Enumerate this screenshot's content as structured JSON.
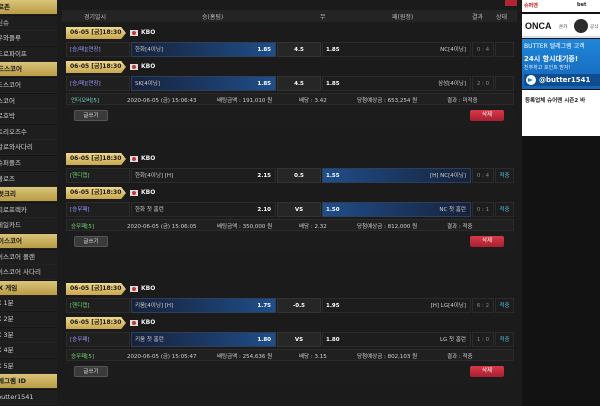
{
  "sidebar": {
    "items": [
      {
        "label": "로존",
        "style": "gold"
      },
      {
        "label": "신슈",
        "style": "dark"
      },
      {
        "label": "우와플루",
        "style": "dark"
      },
      {
        "label": "드로파이프",
        "style": "dark"
      },
      {
        "label": "드스코어",
        "style": "gold"
      },
      {
        "label": "드스코어",
        "style": "dark"
      },
      {
        "label": "스코어",
        "style": "dark"
      },
      {
        "label": "로호박",
        "style": "dark"
      },
      {
        "label": "트리오즈수",
        "style": "dark"
      },
      {
        "label": "알로와사다리",
        "style": "dark"
      },
      {
        "label": "슈퍼플즈",
        "style": "dark"
      },
      {
        "label": "볼로즈",
        "style": "dark"
      },
      {
        "label": "럿크리",
        "style": "gold"
      },
      {
        "label": "피로프렉카",
        "style": "dark"
      },
      {
        "label": "레일카드",
        "style": "dark"
      },
      {
        "label": "이스코어",
        "style": "gold"
      },
      {
        "label": "이스코어 플랜",
        "style": "dark"
      },
      {
        "label": "이스코어 사다리",
        "style": "dark"
      },
      {
        "label": "X 게임",
        "style": "gold"
      },
      {
        "label": "X 1분",
        "style": "dark"
      },
      {
        "label": "X 2분",
        "style": "dark"
      },
      {
        "label": "X 3분",
        "style": "dark"
      },
      {
        "label": "X 4분",
        "style": "dark"
      },
      {
        "label": "X 5분",
        "style": "dark"
      },
      {
        "label": "레그램 ID",
        "style": "gold"
      },
      {
        "label": "butter1541",
        "style": "dark"
      }
    ]
  },
  "header": {
    "col_time": "경기일시",
    "col_home": "승(홈팀)",
    "col_mid": "무",
    "col_away": "패(원정)",
    "col_result": "결과",
    "col_status": "상태"
  },
  "bets": [
    {
      "games": [
        {
          "date": "06-05 [금]18:30",
          "league": "KBO",
          "type": "[승/패][연장]",
          "type_style": "blue",
          "home": "한화[4이닝]",
          "home_odd": "1.85",
          "home_sel": true,
          "mid": "4.5",
          "away_odd": "1.85",
          "away": "NC[4이닝]",
          "away_sel": false,
          "score": "0 : 4",
          "status": ""
        },
        {
          "date": "06-05 [금]18:30",
          "league": "KBO",
          "type": "[승/패][연장]",
          "type_style": "blue",
          "home": "SK[4이닝]",
          "home_odd": "1.85",
          "home_sel": true,
          "mid": "4.5",
          "away_odd": "1.85",
          "away": "삼성[4이닝]",
          "away_sel": false,
          "score": "2 : 0",
          "status": ""
        }
      ],
      "summary": {
        "outcome": "언더오버[5]",
        "time": "2020-06-05 (금) 15:06:43",
        "amount": "배팅금액 : 191,010 원",
        "rate": "배당 : 3.42",
        "expected": "당첨예상금 : 653,254 원",
        "result": "결과 : 미적중"
      },
      "btn_left": "글쓰기",
      "btn_right": "삭제"
    },
    {
      "games": [
        {
          "date": "06-05 [금]18:30",
          "league": "KBO",
          "type": "[핸디캡]",
          "type_style": "green",
          "home": "한화[4이닝] [H]",
          "home_odd": "2.15",
          "home_sel": false,
          "mid": "0.5",
          "away_odd": "1.55",
          "away": "[H] NC[4이닝]",
          "away_sel": true,
          "score": "0 : 4",
          "status": "적중"
        },
        {
          "date": "06-05 [금]18:30",
          "league": "KBO",
          "type": "[승무패]",
          "type_style": "blue",
          "home": "한화 첫 홈런",
          "home_odd": "2.10",
          "home_sel": false,
          "mid": "VS",
          "away_odd": "1.50",
          "away": "NC 첫 홈런",
          "away_sel": true,
          "score": "0 : 1",
          "status": "적중"
        }
      ],
      "summary": {
        "outcome": "승무패[5]",
        "time": "2020-06-05 (금) 15:06:05",
        "amount": "배팅금액 : 350,000 원",
        "rate": "배당 : 2.32",
        "expected": "당첨예상금 : 812,000 원",
        "result": "결과 : 적중"
      },
      "btn_left": "글쓰기",
      "btn_right": "삭제"
    },
    {
      "games": [
        {
          "date": "06-05 [금]18:30",
          "league": "KBO",
          "type": "[핸디캡]",
          "type_style": "green",
          "home": "키움[4이닝] [H]",
          "home_odd": "1.75",
          "home_sel": true,
          "mid": "-0.5",
          "away_odd": "1.95",
          "away": "[H] LG[4이닝]",
          "away_sel": false,
          "score": "6 : 2",
          "status": "적중"
        },
        {
          "date": "06-05 [금]18:30",
          "league": "KBO",
          "type": "[승무패]",
          "type_style": "blue",
          "home": "키움 첫 홈런",
          "home_odd": "1.80",
          "home_sel": true,
          "mid": "VS",
          "away_odd": "1.80",
          "away": "LG 첫 홈런",
          "away_sel": false,
          "score": "1 : 0",
          "status": "적중"
        }
      ],
      "summary": {
        "outcome": "승무패[5]",
        "time": "2020-06-05 (금) 15:05:47",
        "amount": "배팅금액 : 254,636 원",
        "rate": "배당 : 3.15",
        "expected": "당첨예상금 : 802,103 원",
        "result": "결과 : 적중"
      },
      "btn_left": "글쓰기",
      "btn_right": "삭제"
    }
  ],
  "right_panel": {
    "top_ad_a": "슈퍼맨",
    "top_ad_b": "bet",
    "onca": "ONCA",
    "onca_sub1": "온카",
    "onca_sub2": "공식",
    "telegram_title": "BUTTER 텔레그램 고객",
    "telegram_big": "24시 항시대기중!",
    "telegram_sub": "친추하고 포인트 받자!",
    "telegram_id": "@butter1541",
    "notice": "등록업체 슈어맨 시즌2 바"
  }
}
